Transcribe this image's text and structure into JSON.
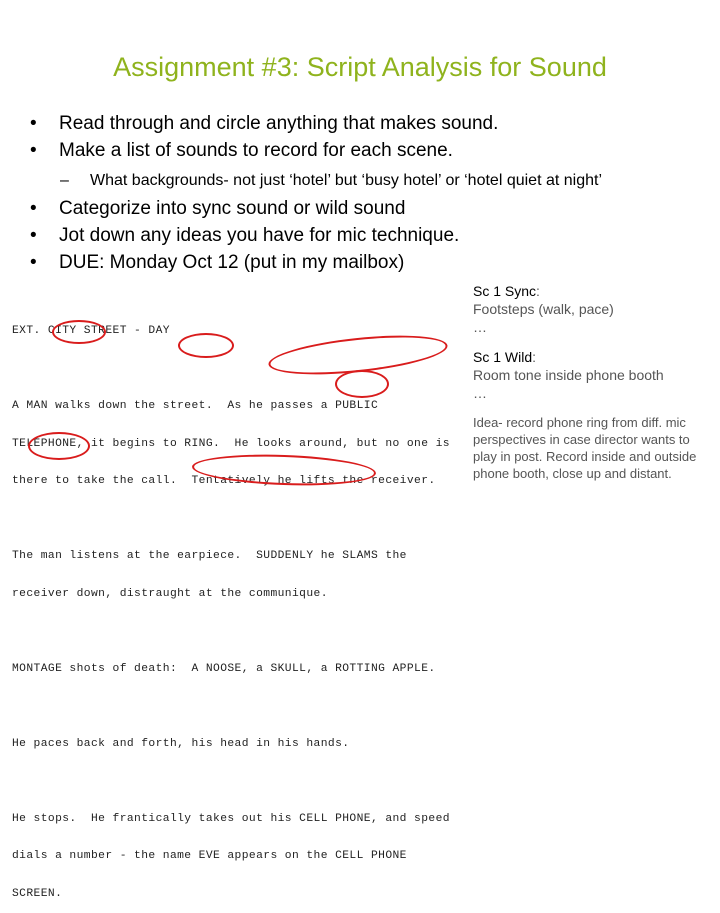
{
  "slide": {
    "title": "Assignment #3: Script Analysis for Sound",
    "bullets": [
      "Read through and circle anything that makes sound.",
      "Make a list of sounds to record for each scene.",
      "Categorize into sync sound or wild sound",
      "Jot down any ideas you have for mic technique.",
      "DUE: Monday Oct 12 (put in my mailbox)"
    ],
    "sub_bullet": "What backgrounds- not just ‘hotel’ but ‘busy hotel’ or ‘hotel quiet at night’",
    "bullet_glyph": "•",
    "dash_glyph": "–"
  },
  "script": {
    "lines": [
      "EXT. CITY STREET - DAY",
      "",
      "A MAN walks down the street.  As he passes a PUBLIC",
      "TELEPHONE, it begins to RING.  He looks around, but no one is",
      "there to take the call.  Tentatively he lifts the receiver.",
      "",
      "The man listens at the earpiece.  SUDDENLY he SLAMS the",
      "receiver down, distraught at the communique.",
      "",
      "MONTAGE shots of death:  A NOOSE, a SKULL, a ROTTING APPLE.",
      "",
      "He paces back and forth, his head in his hands.",
      "",
      "He stops.  He frantically takes out his CELL PHONE, and speed",
      "dials a number - the name EVE appears on the CELL PHONE",
      "SCREEN."
    ]
  },
  "notes": {
    "sync_head": "Sc 1 Sync",
    "sync_colon": ":",
    "sync_body": "Footsteps (walk, pace)",
    "sync_more": "…",
    "wild_head": "Sc 1 Wild",
    "wild_colon": ":",
    "wild_body": "Room tone inside phone booth",
    "wild_more": "…",
    "idea": "Idea- record phone ring from diff. mic perspectives in case director wants to play in post. Record inside and outside phone booth, close up and distant."
  }
}
